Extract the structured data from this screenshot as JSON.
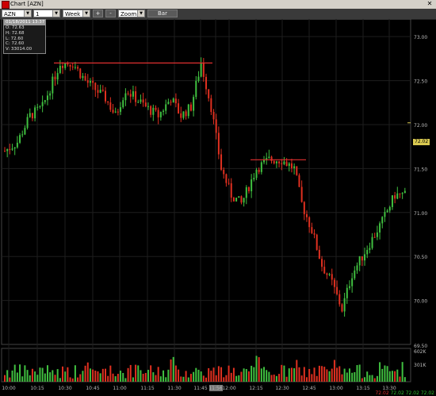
{
  "window": {
    "title": "Chart [AZN]"
  },
  "toolbar": {
    "symbol": "AZN",
    "interval": "1 minute",
    "range": "Week",
    "zoom_in": "+",
    "zoom_out": "-",
    "zoom_label": "Zoom",
    "bar_button": "Bar"
  },
  "info": {
    "header": "01/18/2011 13:37",
    "open": "O: 72.63",
    "high": "H: 72.68",
    "low": "L: 72.60",
    "close": "C: 72.60",
    "volume": "V: 33014.00"
  },
  "price_axis": [
    "73.00",
    "72.50",
    "72.00",
    "71.50",
    "71.00",
    "70.50",
    "70.00"
  ],
  "volume_axis": [
    "69.50",
    "602K",
    "301K"
  ],
  "last_price": "72.02",
  "time_axis": [
    "10:00",
    "10:15",
    "10:30",
    "10:45",
    "11:00",
    "11:15",
    "11:30",
    "11:45",
    "11:56",
    "12:00",
    "12:15",
    "12:30",
    "12:45",
    "13:00",
    "13:15",
    "13:30"
  ],
  "status": {
    "v1": "72.02",
    "v2": "72.02",
    "v3": "72.02",
    "v4": "72.02"
  },
  "colors": {
    "up": "#40c040",
    "down": "#e03020",
    "resistance": "#e03030"
  },
  "chart_data": {
    "type": "candlestick",
    "x": "time",
    "ylim": [
      69.5,
      73.2
    ],
    "resistance": [
      72.7,
      71.6
    ],
    "path": [
      [
        0,
        71.7
      ],
      [
        5,
        71.8
      ],
      [
        10,
        72.1
      ],
      [
        15,
        72.2
      ],
      [
        22,
        72.7
      ],
      [
        27,
        72.7
      ],
      [
        32,
        72.5
      ],
      [
        36,
        72.4
      ],
      [
        40,
        72.3
      ],
      [
        44,
        72.1
      ],
      [
        48,
        72.4
      ],
      [
        52,
        72.3
      ],
      [
        56,
        72.2
      ],
      [
        61,
        72.1
      ],
      [
        66,
        72.3
      ],
      [
        70,
        72.1
      ],
      [
        74,
        72.2
      ],
      [
        78,
        72.7
      ],
      [
        82,
        72.2
      ],
      [
        86,
        71.5
      ],
      [
        90,
        71.2
      ],
      [
        94,
        71.1
      ],
      [
        100,
        71.5
      ],
      [
        105,
        71.6
      ],
      [
        110,
        71.6
      ],
      [
        115,
        71.5
      ],
      [
        118,
        71.1
      ],
      [
        122,
        70.8
      ],
      [
        126,
        70.4
      ],
      [
        130,
        70.2
      ],
      [
        134,
        69.9
      ],
      [
        138,
        70.3
      ],
      [
        142,
        70.5
      ],
      [
        146,
        70.7
      ],
      [
        150,
        70.9
      ],
      [
        155,
        71.2
      ]
    ]
  }
}
